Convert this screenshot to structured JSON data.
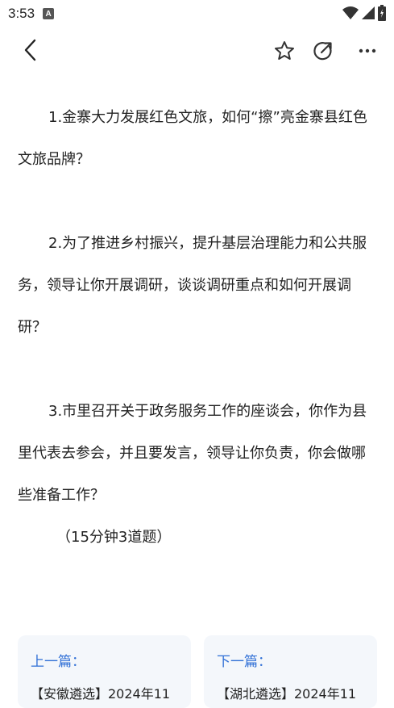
{
  "status": {
    "time": "3:53",
    "notif_glyph": "A"
  },
  "nav": {
    "icons": [
      "back-icon",
      "star-icon",
      "share-icon",
      "more-icon"
    ]
  },
  "article": {
    "q1": "1.金寨大力发展红色文旅，如何“擦”亮金寨县红色文旅品牌？",
    "q2": "2.为了推进乡村振兴，提升基层治理能力和公共服务，领导让你开展调研，谈谈调研重点和如何开展调研？",
    "q3": "3.市里召开关于政务服务工作的座谈会，你作为县里代表去参会，并且要发言，领导让你负责，你会做哪些准备工作？",
    "note": "（15分钟3道题）"
  },
  "related": {
    "prev_label": "上一篇：",
    "prev_title": "【安徽遴选】2024年11",
    "next_label": "下一篇：",
    "next_title": "【湖北遴选】2024年11"
  },
  "colors": {
    "link_blue": "#2f6fd6",
    "card_bg": "#f4f7fb",
    "text": "#222222"
  }
}
